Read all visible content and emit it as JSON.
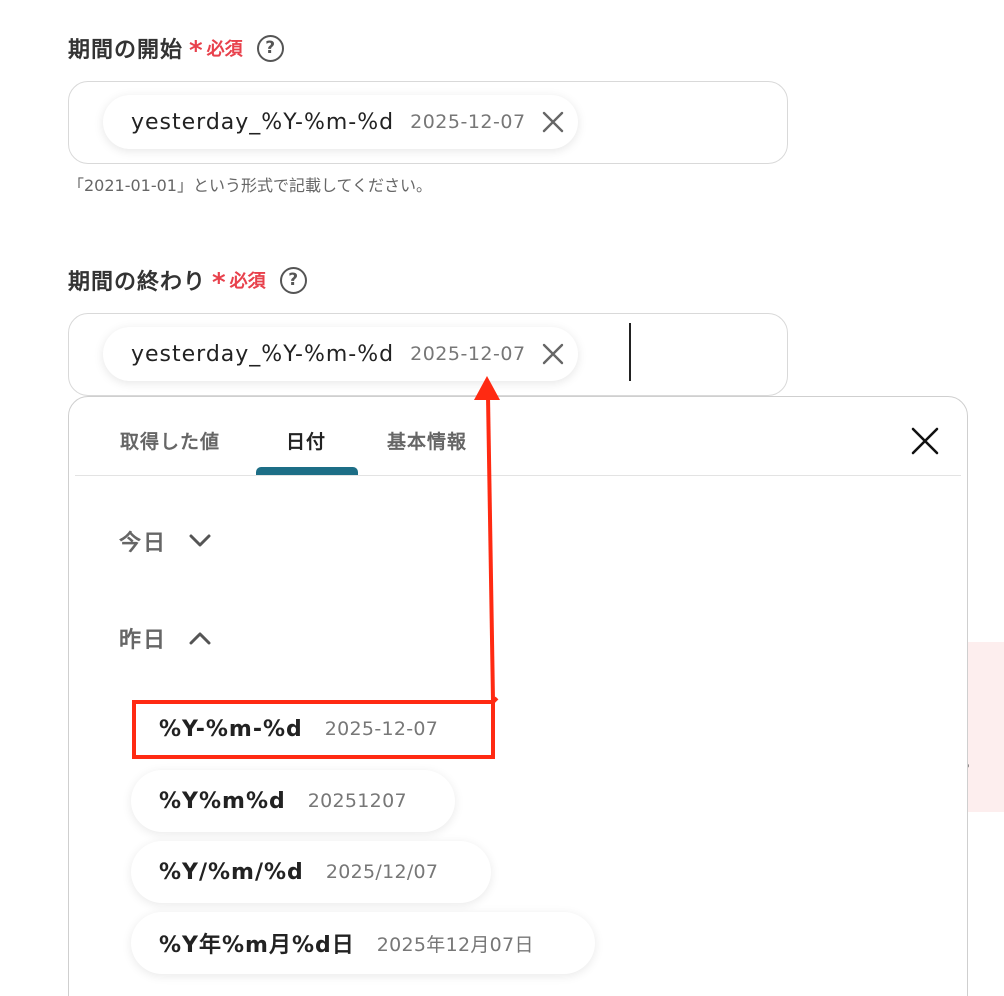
{
  "start_field": {
    "label": "期間の開始",
    "required_star": "*",
    "required_text": "必須",
    "help": "?",
    "chip_name": "yesterday_%Y-%m-%d",
    "chip_value": "2025-12-07",
    "hint": "「2021-01-01」という形式で記載してください。"
  },
  "end_field": {
    "label": "期間の終わり",
    "required_star": "*",
    "required_text": "必須",
    "help": "?",
    "chip_name": "yesterday_%Y-%m-%d",
    "chip_value": "2025-12-07"
  },
  "panel": {
    "tabs": [
      {
        "label": "取得した値",
        "active": false
      },
      {
        "label": "日付",
        "active": true
      },
      {
        "label": "基本情報",
        "active": false
      }
    ],
    "sections": [
      {
        "label": "今日",
        "expanded": false
      },
      {
        "label": "昨日",
        "expanded": true
      }
    ],
    "options": [
      {
        "name": "%Y-%m-%d",
        "value": "2025-12-07",
        "highlighted": true
      },
      {
        "name": "%Y%m%d",
        "value": "20251207",
        "highlighted": false
      },
      {
        "name": "%Y/%m/%d",
        "value": "2025/12/07",
        "highlighted": false
      },
      {
        "name": "%Y年%m月%d日",
        "value": "2025年12月07日",
        "highlighted": false
      }
    ]
  },
  "background": {
    "clipped_text": "。"
  },
  "colors": {
    "required": "#e8414c",
    "tab_indicator": "#1d6e86",
    "annotation": "#ff2a12"
  }
}
